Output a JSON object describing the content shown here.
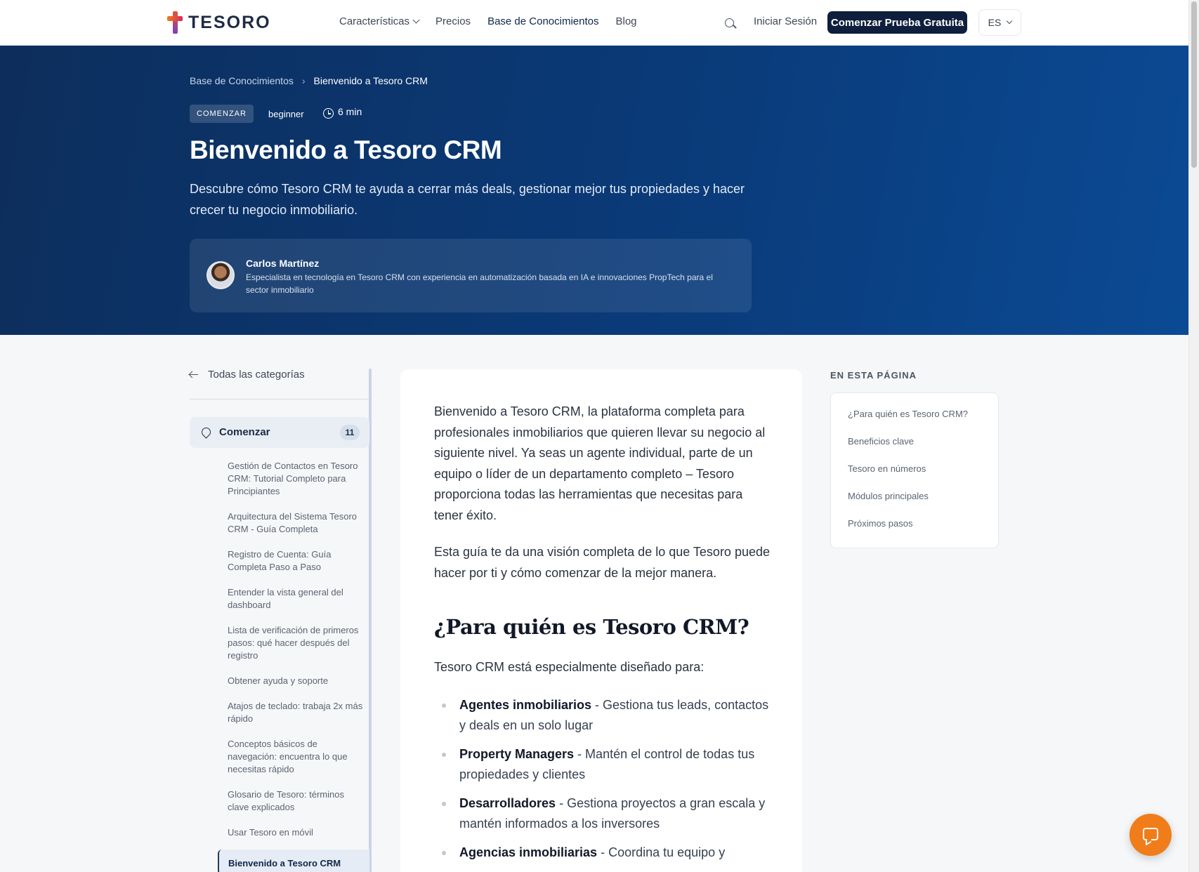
{
  "nav": {
    "brand": "TESORO",
    "links": [
      {
        "label": "Características"
      },
      {
        "label": "Precios"
      },
      {
        "label": "Base de Conocimientos"
      },
      {
        "label": "Blog"
      }
    ],
    "login": "Iniciar Sesión",
    "cta": "Comenzar Prueba Gratuita",
    "lang": "ES"
  },
  "hero": {
    "breadcrumbs": [
      "Base de Conocimientos",
      "Bienvenido a Tesoro CRM"
    ],
    "badge": "COMENZAR",
    "level": "beginner",
    "read_time": "6 min",
    "title": "Bienvenido a Tesoro CRM",
    "lead": "Descubre cómo Tesoro CRM te ayuda a cerrar más deals, gestionar mejor tus propiedades y hacer crecer tu negocio inmobiliario.",
    "author": {
      "name": "Carlos Martínez",
      "bio": "Especialista en tecnología en Tesoro CRM con experiencia en automatización basada en IA e innovaciones PropTech para el sector inmobiliario"
    }
  },
  "sidebar": {
    "back": "Todas las categorías",
    "category": {
      "label": "Comenzar",
      "count": "11"
    },
    "articles": [
      "Gestión de Contactos en Tesoro CRM: Tutorial Completo para Principiantes",
      "Arquitectura del Sistema Tesoro CRM - Guía Completa",
      "Registro de Cuenta: Guía Completa Paso a Paso",
      "Entender la vista general del dashboard",
      "Lista de verificación de primeros pasos: qué hacer después del registro",
      "Obtener ayuda y soporte",
      "Atajos de teclado: trabaja 2x más rápido",
      "Conceptos básicos de navegación: encuentra lo que necesitas rápido",
      "Glosario de Tesoro: términos clave explicados",
      "Usar Tesoro en móvil"
    ],
    "active": "Bienvenido a Tesoro CRM"
  },
  "article": {
    "intro": "Bienvenido a Tesoro CRM, la plataforma completa para profesionales inmobiliarios que quieren llevar su negocio al siguiente nivel. Ya seas un agente individual, parte de un equipo o líder de un departamento completo – Tesoro proporciona todas las herramientas que necesitas para tener éxito.",
    "guide": "Esta guía te da una visión completa de lo que Tesoro puede hacer por ti y cómo comenzar de la mejor manera.",
    "heading": "¿Para quién es Tesoro CRM?",
    "designed_for": "Tesoro CRM está especialmente diseñado para:",
    "bullets": [
      {
        "term": "Agentes inmobiliarios",
        "desc": " - Gestiona tus leads, contactos y deals en un solo lugar"
      },
      {
        "term": "Property Managers",
        "desc": " - Mantén el control de todas tus propiedades y clientes"
      },
      {
        "term": "Desarrolladores",
        "desc": " - Gestiona proyectos a gran escala y mantén informados a los inversores"
      },
      {
        "term": "Agencias inmobiliarias",
        "desc": " - Coordina tu equipo y"
      }
    ]
  },
  "toc": {
    "title": "EN ESTA PÁGINA",
    "items": [
      "¿Para quién es Tesoro CRM?",
      "Beneficios clave",
      "Tesoro en números",
      "Módulos principales",
      "Próximos pasos"
    ]
  }
}
